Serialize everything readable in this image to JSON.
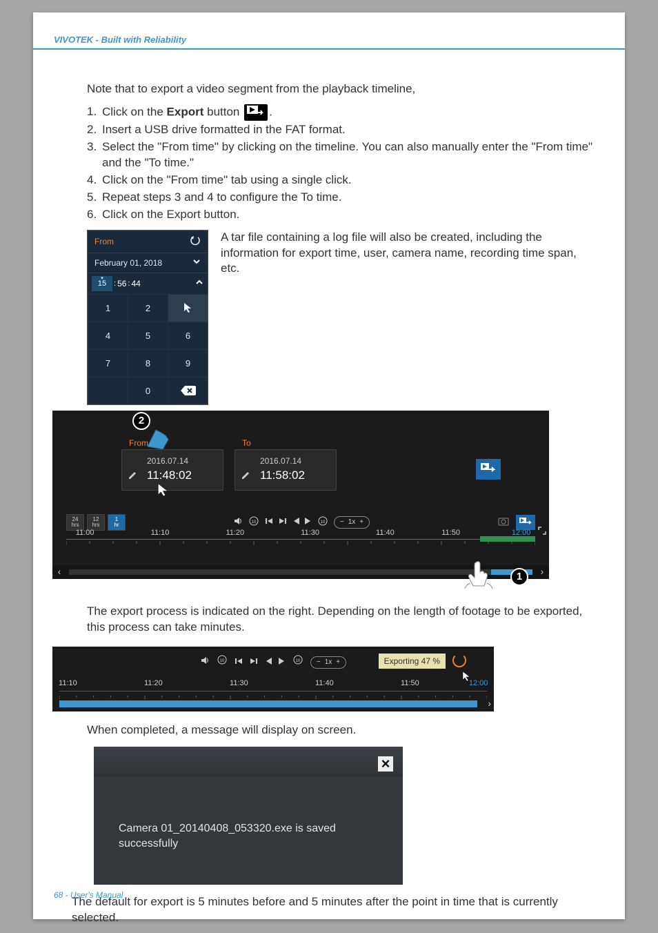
{
  "header": {
    "text": "VIVOTEK - Built with Reliability"
  },
  "intro": "Note that to export a video segment from the playback timeline,",
  "steps": {
    "s1_prefix": "1. ",
    "s1a": "Click on the ",
    "s1_bold": "Export",
    "s1b": " button ",
    "s1c": ". ",
    "s2_prefix": "2. ",
    "s2": "Insert a USB drive formatted in the FAT format.",
    "s3_prefix": "3. ",
    "s3": "Select the \"From time\" by clicking on the timeline. You can also manually enter the \"From time\" and the \"To time.\"",
    "s4_prefix": "4. ",
    "s4": "Click on the \"From time\" tab using a single click.",
    "s5_prefix": "5. ",
    "s5": "Repeat steps 3 and 4 to configure the To time.",
    "s6_prefix": "6. ",
    "s6": "Click on the Export button."
  },
  "tar_note": "A tar file containing a log file will also be created, including the information for export time, user, camera name, recording time span, etc.",
  "from_panel": {
    "from_label": "From",
    "date": "February 01, 2018",
    "hh": "15",
    "mm": "56",
    "ss": "44",
    "keys": [
      "1",
      "2",
      "",
      "4",
      "5",
      "6",
      "7",
      "8",
      "9",
      "",
      "0",
      ""
    ]
  },
  "ft": {
    "from_label": "From",
    "to_label": "To",
    "date1": "2016.07.14",
    "time1": "11:48:02",
    "date2": "2016.07.14",
    "time2": "11:58:02"
  },
  "zoom": {
    "a": "24\nhrs",
    "b": "12\nhrs",
    "c": "1\nhr"
  },
  "speed": {
    "minus": "−",
    "val": "1x",
    "plus": "+"
  },
  "ruler1": {
    "t0": "11:00",
    "t1": "11:10",
    "t2": "11:20",
    "t3": "11:30",
    "t4": "11:40",
    "t5": "11:50",
    "t6": "12:00"
  },
  "callouts": {
    "one": "1",
    "two": "2"
  },
  "export_para": "The export process is indicated on the right. Depending on the length of footage to be exported, this process can take minutes.",
  "exporting": {
    "badge": "Exporting 47 %",
    "r0": "11:10",
    "r1": "11:20",
    "r2": "11:30",
    "r3": "11:40",
    "r4": "11:50",
    "r5": "12:00",
    "speed_minus": "−",
    "speed_val": "1x",
    "speed_plus": "+"
  },
  "completed_para": "When completed, a message will display on screen.",
  "modal": {
    "msg": "Camera 01_20140408_053320.exe is saved successfully",
    "close": "×"
  },
  "default_para": "The default for export is 5 minutes before and 5 minutes after the point in time that is currently selected.",
  "footer": "68 - User's Manual"
}
